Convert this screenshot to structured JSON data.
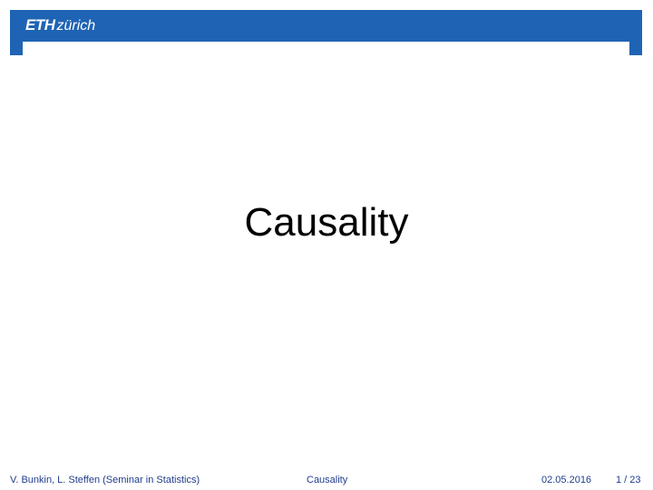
{
  "header": {
    "logo_bold": "ETH",
    "logo_italic": "zürich"
  },
  "slide": {
    "title": "Causality"
  },
  "footer": {
    "authors": "V. Bunkin, L. Steffen  (Seminar in Statistics)",
    "title": "Causality",
    "date": "02.05.2016",
    "page": "1 / 23"
  },
  "colors": {
    "brand_blue": "#1f64b4",
    "footer_text": "#1f3c8c"
  }
}
